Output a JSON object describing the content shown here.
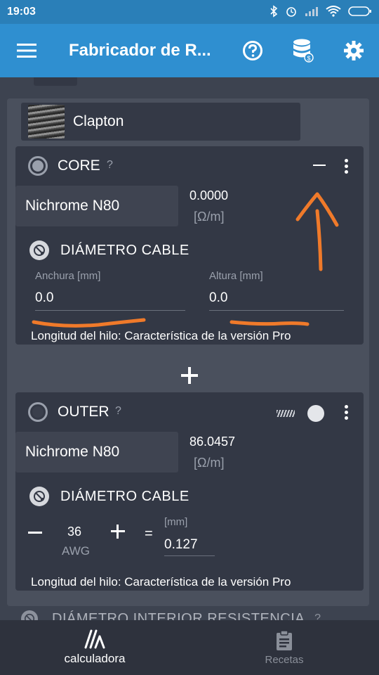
{
  "status_bar": {
    "time": "19:03"
  },
  "app_bar": {
    "title": "Fabricador de R...",
    "menu_icon": "hamburger-menu-icon",
    "help_icon": "help-circle-icon",
    "database_icon": "database-icon",
    "settings_icon": "gear-icon"
  },
  "coil": {
    "type_label": "Clapton"
  },
  "core": {
    "name": "CORE",
    "help": "?",
    "material": "Nichrome N80",
    "resistance": "0.0000",
    "resistance_unit": "[Ω/m]",
    "diameter_label": "DIÁMETRO CABLE",
    "width_label": "Anchura [mm]",
    "width_value": "0.0",
    "height_label": "Altura [mm]",
    "height_value": "0.0",
    "length_note": "Longitud del hilo: Característica de la versión Pro"
  },
  "add_wire_symbol": "+",
  "outer": {
    "name": "OUTER",
    "help": "?",
    "material": "Nichrome N80",
    "resistance": "86.0457",
    "resistance_unit": "[Ω/m]",
    "diameter_label": "DIÁMETRO CABLE",
    "awg_value": "36",
    "awg_unit": "AWG",
    "equals": "=",
    "mm_label": "[mm]",
    "mm_value": "0.127",
    "length_note": "Longitud del hilo: Característica de la versión Pro"
  },
  "next_section": {
    "label": "DIÁMETRO INTERIOR RESISTENCIA",
    "help": "?"
  },
  "bottom_nav": {
    "items": [
      {
        "label": "calculadora",
        "icon": "calculator-icon",
        "active": true
      },
      {
        "label": "Recetas",
        "icon": "clipboard-icon",
        "active": false
      }
    ]
  },
  "colors": {
    "status_bar": "#2a7fb8",
    "app_bar": "#2f8fd0",
    "background": "#3d4350",
    "card": "#333845",
    "annotation": "#f07a2a"
  }
}
